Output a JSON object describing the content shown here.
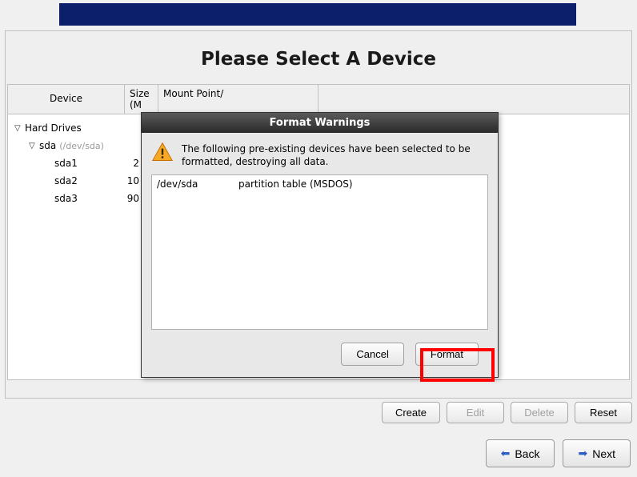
{
  "page_title": "Please Select A Device",
  "table_headers": {
    "device": "Device",
    "size": "Size\n(M",
    "mount": "Mount Point/"
  },
  "tree": {
    "root_label": "Hard Drives",
    "disk": {
      "label": "sda",
      "devpath": "(/dev/sda)"
    },
    "partitions": [
      {
        "label": "sda1",
        "size_fragment": "2"
      },
      {
        "label": "sda2",
        "size_fragment": "10"
      },
      {
        "label": "sda3",
        "size_fragment": "90"
      }
    ]
  },
  "action_buttons": {
    "create": "Create",
    "edit": "Edit",
    "delete": "Delete",
    "reset": "Reset"
  },
  "nav": {
    "back": "Back",
    "next": "Next"
  },
  "dialog": {
    "title": "Format Warnings",
    "message": "The following pre-existing devices have been selected to be formatted, destroying all data.",
    "devices": [
      {
        "path": "/dev/sda",
        "desc": "partition table (MSDOS)"
      }
    ],
    "cancel": "Cancel",
    "format": "Format"
  }
}
